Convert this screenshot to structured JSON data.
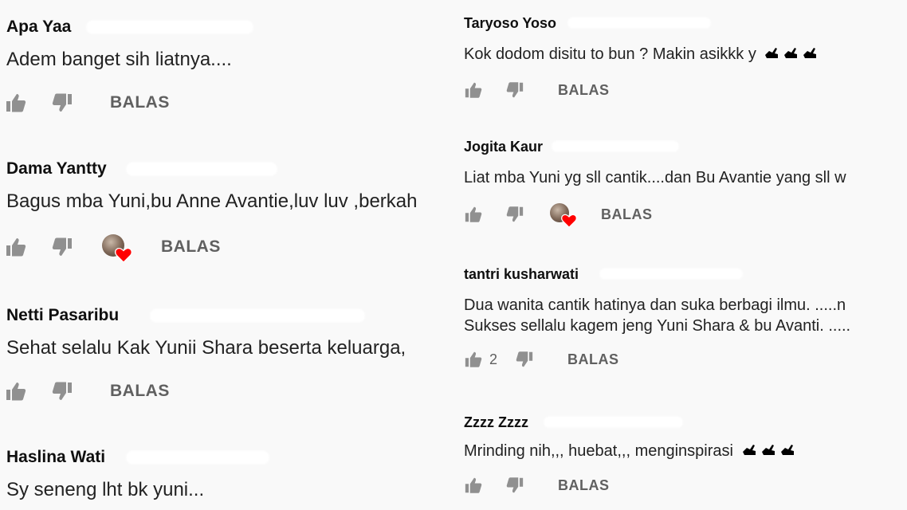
{
  "left_comments": [
    {
      "author": "Apa Yaa",
      "lines": [
        "Adem banget sih liatnya...."
      ],
      "like_count": "",
      "reply_label": "BALAS",
      "creator_heart": false
    },
    {
      "author": "Dama Yantty",
      "lines": [
        "Bagus mba Yuni,bu Anne Avantie,luv luv ,berkah"
      ],
      "like_count": "",
      "reply_label": "BALAS",
      "creator_heart": true
    },
    {
      "author": "Netti Pasaribu",
      "lines": [
        "Sehat selalu Kak Yunii Shara beserta keluarga,"
      ],
      "like_count": "",
      "reply_label": "BALAS",
      "creator_heart": false
    },
    {
      "author": "Haslina Wati",
      "lines": [
        "Sy seneng lht bk yuni..."
      ],
      "like_count": "",
      "reply_label": "",
      "creator_heart": false
    }
  ],
  "right_comments": [
    {
      "author": "Taryoso Yoso",
      "lines": [
        "Kok dodom disitu to bun ? Makin asikkk y"
      ],
      "emoji": "pointing-hand-icon",
      "like_count": "",
      "reply_label": "BALAS",
      "creator_heart": false
    },
    {
      "author": "Jogita Kaur",
      "lines": [
        "Liat mba Yuni yg sll cantik....dan Bu Avantie yang sll w"
      ],
      "like_count": "",
      "reply_label": "BALAS",
      "creator_heart": true
    },
    {
      "author": "tantri kusharwati",
      "lines": [
        "Dua wanita cantik hatinya dan suka berbagi ilmu. .....n",
        "Sukses sellalu kagem jeng Yuni Shara & bu Avanti. ....."
      ],
      "like_count": "2",
      "reply_label": "BALAS",
      "creator_heart": false
    },
    {
      "author": "Zzzz Zzzz",
      "lines": [
        "Mrinding nih,,, huebat,,, menginspirasi"
      ],
      "emoji": "pointing-hand-icon",
      "like_count": "",
      "reply_label": "BALAS",
      "creator_heart": false
    }
  ],
  "colors": {
    "background": "#f9f9f9",
    "icon": "#909090",
    "heart": "#ff0000",
    "text": "#222222"
  }
}
